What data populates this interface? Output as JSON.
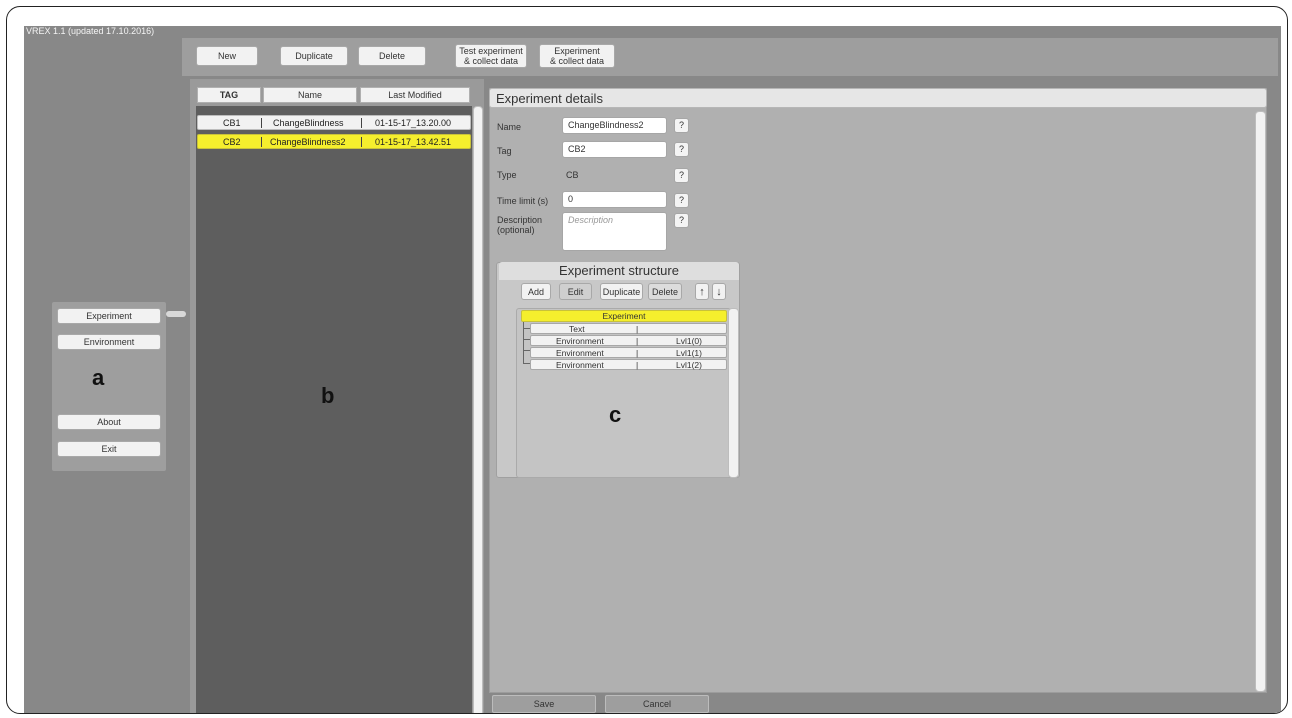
{
  "app_title": "VREX 1.1 (updated 17.10.2016)",
  "toolbar": {
    "new_label": "New",
    "duplicate_label": "Duplicate",
    "delete_label": "Delete",
    "test_line1": "Test experiment",
    "test_line2": "& collect data",
    "exp_line1": "Experiment",
    "exp_line2": "& collect data"
  },
  "side_menu": {
    "experiment": "Experiment",
    "environment": "Environment",
    "about": "About",
    "exit": "Exit"
  },
  "annotations": {
    "a": "a",
    "b": "b",
    "c": "c"
  },
  "list": {
    "headers": [
      "TAG",
      "Name",
      "Last Modified"
    ],
    "rows": [
      {
        "tag": "CB1",
        "name": "ChangeBlindness",
        "modified": "01-15-17_13.20.00",
        "selected": false
      },
      {
        "tag": "CB2",
        "name": "ChangeBlindness2",
        "modified": "01-15-17_13.42.51",
        "selected": true
      }
    ]
  },
  "details": {
    "title": "Experiment details",
    "name_label": "Name",
    "name_value": "ChangeBlindness2",
    "tag_label": "Tag",
    "tag_value": "CB2",
    "type_label": "Type",
    "type_value": "CB",
    "time_label": "Time limit (s)",
    "time_value": "0",
    "desc_label_1": "Description",
    "desc_label_2": "(optional)",
    "desc_placeholder": "Description",
    "help": "?"
  },
  "structure": {
    "title": "Experiment structure",
    "add": "Add",
    "edit": "Edit",
    "duplicate": "Duplicate",
    "delete": "Delete",
    "up": "↑",
    "down": "↓",
    "root": "Experiment",
    "items": [
      {
        "type": "Text",
        "sep": "|",
        "level": ""
      },
      {
        "type": "Environment",
        "sep": "|",
        "level": "Lvl1(0)"
      },
      {
        "type": "Environment",
        "sep": "|",
        "level": "Lvl1(1)"
      },
      {
        "type": "Environment",
        "sep": "|",
        "level": "Lvl1(2)"
      }
    ]
  },
  "footer": {
    "save": "Save",
    "cancel": "Cancel"
  },
  "colors": {
    "highlight": "#f5ef2d",
    "panel_dark": "#5e5e5e",
    "panel_bg": "#888888"
  }
}
